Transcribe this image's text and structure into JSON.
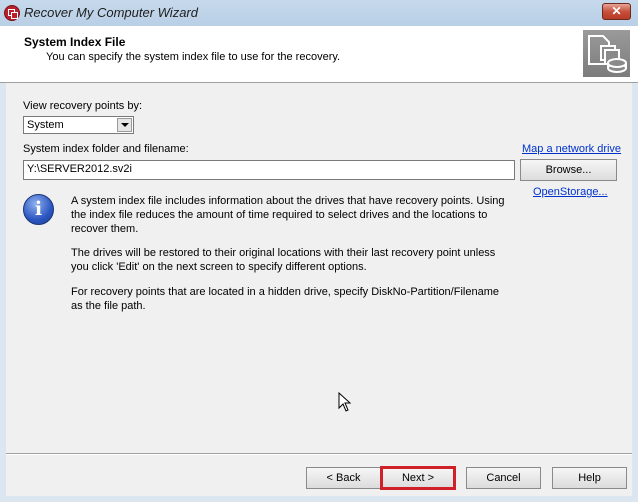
{
  "window": {
    "title": "Recover My Computer Wizard",
    "app_icon": "app-logo-icon",
    "close_icon": "close-icon",
    "close_glyph": "✕"
  },
  "header": {
    "title": "System Index File",
    "subtitle": "You can specify the system index file to use for the recovery.",
    "icon": "system-index-icon"
  },
  "form": {
    "view_by_label": "View recovery points by:",
    "view_by_value": "System",
    "index_label": "System index folder and filename:",
    "index_value": "Y:\\SERVER2012.sv2i",
    "map_drive_link": "Map a network drive",
    "browse_label": "Browse...",
    "openstorage_link": "OpenStorage..."
  },
  "info": {
    "icon": "info-icon",
    "glyph": "i",
    "paragraphs": [
      "A system index file includes information about the drives that have recovery points. Using the index file reduces the amount of time required to select drives and the locations to recover them.",
      "The drives will be restored to their original locations with their last recovery point unless you click 'Edit' on the next screen to specify different options.",
      "For recovery points that are located in a hidden drive, specify DiskNo-Partition/Filename as the file path."
    ]
  },
  "footer": {
    "back_label": "< Back",
    "next_label": "Next >",
    "cancel_label": "Cancel",
    "help_label": "Help",
    "highlight_color": "#d0202a"
  }
}
